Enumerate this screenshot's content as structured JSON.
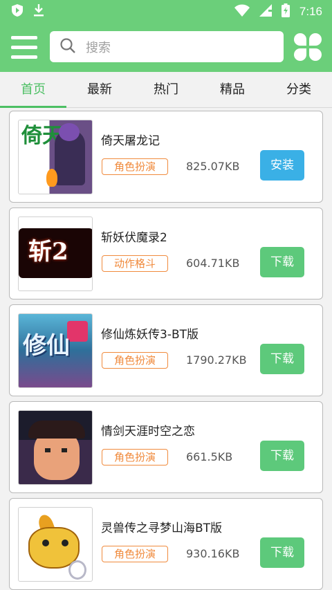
{
  "status_bar": {
    "time": "7:16"
  },
  "header": {
    "search_placeholder": "搜索",
    "icons": {
      "menu": "hamburger-menu-icon",
      "search": "search-icon",
      "grid": "clover-grid-icon"
    }
  },
  "tabs": [
    {
      "label": "首页",
      "active": true
    },
    {
      "label": "最新",
      "active": false
    },
    {
      "label": "热门",
      "active": false
    },
    {
      "label": "精品",
      "active": false
    },
    {
      "label": "分类",
      "active": false
    }
  ],
  "games": [
    {
      "title": "倚天屠龙记",
      "category": "角色扮演",
      "size": "825.07KB",
      "action": "安装",
      "action_color": "#3ab0e6",
      "thumb_text": "倚天"
    },
    {
      "title": "斩妖伏魔录2",
      "category": "动作格斗",
      "size": "604.71KB",
      "action": "下载",
      "action_color": "#5dc97b",
      "thumb_text": "斩2"
    },
    {
      "title": "修仙炼妖传3-BT版",
      "category": "角色扮演",
      "size": "1790.27KB",
      "action": "下载",
      "action_color": "#5dc97b",
      "thumb_text": "修仙"
    },
    {
      "title": "情剑天涯时空之恋",
      "category": "角色扮演",
      "size": "661.5KB",
      "action": "下载",
      "action_color": "#5dc97b",
      "thumb_text": ""
    },
    {
      "title": "灵兽传之寻梦山海BT版",
      "category": "角色扮演",
      "size": "930.16KB",
      "action": "下载",
      "action_color": "#5dc97b",
      "thumb_text": ""
    }
  ],
  "colors": {
    "brand": "#6bcf7a",
    "accent": "#4cbf63",
    "tag": "#f08a3c",
    "install": "#3ab0e6"
  }
}
